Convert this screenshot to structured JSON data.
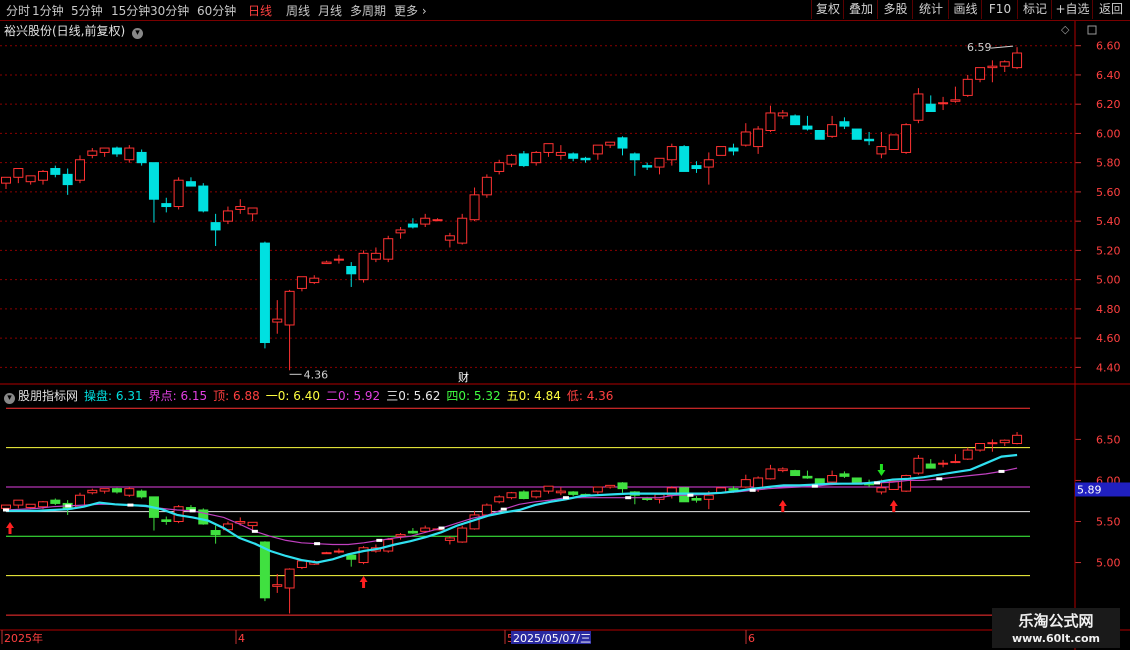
{
  "toolbar": {
    "periods": [
      "分时",
      "1分钟",
      "5分钟",
      "15分钟",
      "30分钟",
      "60分钟",
      "日线",
      "周线",
      "月线",
      "多周期",
      "更多"
    ],
    "active_period": "日线",
    "right_buttons": [
      "复权",
      "叠加",
      "多股",
      "统计",
      "画线",
      "F10",
      "标记",
      "+自选",
      "返回"
    ]
  },
  "main_panel": {
    "title": "裕兴股份(日线,前复权)",
    "high_label": "6.59",
    "low_label": "4.36",
    "finance_marker": "财",
    "y_ticks": [
      "6.60",
      "6.40",
      "6.20",
      "6.00",
      "5.80",
      "5.60",
      "5.40",
      "5.20",
      "5.00",
      "4.80",
      "4.60",
      "4.40"
    ]
  },
  "indicator_panel": {
    "title": "股朋指标网",
    "values": [
      {
        "label": "操盘:",
        "value": "6.31",
        "color": "#00e0e0"
      },
      {
        "label": "界点:",
        "value": "6.15",
        "color": "#e040e0"
      },
      {
        "label": "顶:",
        "value": "6.88",
        "color": "#ff4040"
      },
      {
        "label": "一0:",
        "value": "6.40",
        "color": "#ffff40"
      },
      {
        "label": "二0:",
        "value": "5.92",
        "color": "#e040e0"
      },
      {
        "label": "三0:",
        "value": "5.62",
        "color": "#e8e8e8"
      },
      {
        "label": "四0:",
        "value": "5.32",
        "color": "#40ff40"
      },
      {
        "label": "五0:",
        "value": "4.84",
        "color": "#ffff40"
      },
      {
        "label": "低:",
        "value": "4.36",
        "color": "#ff4040"
      }
    ],
    "y_ticks": [
      "6.50",
      "6.00",
      "5.50",
      "5.00"
    ],
    "current_price_tag": "5.89"
  },
  "time_axis": {
    "labels": [
      "2025年",
      "4",
      "5",
      "6"
    ],
    "cursor_date": "2025/05/07/三"
  },
  "watermark": {
    "line1": "乐淘公式网",
    "line2": "www.60lt.com"
  },
  "colors": {
    "up": "#ff3232",
    "down": "#00e0e0",
    "grid": "#8a0000",
    "bg": "#000000",
    "blue_line": "#2020c0",
    "magenta_line": "#a020c0"
  },
  "candles": [
    [
      5.66,
      5.7,
      5.62,
      5.7
    ],
    [
      5.7,
      5.76,
      5.66,
      5.76
    ],
    [
      5.67,
      5.71,
      5.65,
      5.71
    ],
    [
      5.68,
      5.75,
      5.65,
      5.74
    ],
    [
      5.76,
      5.78,
      5.7,
      5.72
    ],
    [
      5.72,
      5.76,
      5.58,
      5.65
    ],
    [
      5.68,
      5.85,
      5.66,
      5.82
    ],
    [
      5.85,
      5.9,
      5.83,
      5.88
    ],
    [
      5.87,
      5.9,
      5.84,
      5.9
    ],
    [
      5.9,
      5.91,
      5.84,
      5.86
    ],
    [
      5.82,
      5.92,
      5.8,
      5.9
    ],
    [
      5.87,
      5.89,
      5.78,
      5.8
    ],
    [
      5.8,
      5.8,
      5.39,
      5.55
    ],
    [
      5.52,
      5.56,
      5.46,
      5.5
    ],
    [
      5.5,
      5.7,
      5.48,
      5.68
    ],
    [
      5.67,
      5.7,
      5.64,
      5.64
    ],
    [
      5.64,
      5.66,
      5.46,
      5.47
    ],
    [
      5.39,
      5.45,
      5.23,
      5.34
    ],
    [
      5.4,
      5.5,
      5.38,
      5.47
    ],
    [
      5.48,
      5.55,
      5.45,
      5.5
    ],
    [
      5.45,
      5.49,
      5.4,
      5.49
    ],
    [
      5.25,
      5.26,
      4.53,
      4.57
    ],
    [
      4.71,
      4.86,
      4.63,
      4.73
    ],
    [
      4.69,
      4.93,
      4.38,
      4.92
    ],
    [
      4.94,
      5.02,
      4.92,
      5.02
    ],
    [
      4.98,
      5.03,
      4.97,
      5.01
    ],
    [
      5.11,
      5.13,
      5.11,
      5.12
    ],
    [
      5.14,
      5.17,
      5.11,
      5.14
    ],
    [
      5.09,
      5.12,
      4.95,
      5.04
    ],
    [
      5.0,
      5.2,
      4.98,
      5.18
    ],
    [
      5.14,
      5.22,
      5.12,
      5.18
    ],
    [
      5.14,
      5.3,
      5.12,
      5.28
    ],
    [
      5.32,
      5.36,
      5.28,
      5.34
    ],
    [
      5.38,
      5.42,
      5.35,
      5.36
    ],
    [
      5.38,
      5.45,
      5.36,
      5.42
    ],
    [
      5.41,
      5.42,
      5.4,
      5.41
    ],
    [
      5.27,
      5.32,
      5.22,
      5.3
    ],
    [
      5.25,
      5.45,
      5.24,
      5.42
    ],
    [
      5.41,
      5.63,
      5.4,
      5.58
    ],
    [
      5.58,
      5.72,
      5.56,
      5.7
    ],
    [
      5.74,
      5.82,
      5.72,
      5.8
    ],
    [
      5.79,
      5.86,
      5.77,
      5.85
    ],
    [
      5.86,
      5.88,
      5.77,
      5.78
    ],
    [
      5.8,
      5.88,
      5.78,
      5.87
    ],
    [
      5.87,
      5.93,
      5.84,
      5.93
    ],
    [
      5.85,
      5.92,
      5.82,
      5.87
    ],
    [
      5.86,
      5.87,
      5.81,
      5.83
    ],
    [
      5.83,
      5.84,
      5.8,
      5.82
    ],
    [
      5.86,
      5.92,
      5.82,
      5.92
    ],
    [
      5.92,
      5.94,
      5.9,
      5.94
    ],
    [
      5.97,
      5.98,
      5.85,
      5.9
    ],
    [
      5.86,
      5.87,
      5.71,
      5.82
    ],
    [
      5.78,
      5.8,
      5.75,
      5.77
    ],
    [
      5.77,
      5.83,
      5.72,
      5.83
    ],
    [
      5.82,
      5.93,
      5.78,
      5.91
    ],
    [
      5.91,
      5.92,
      5.74,
      5.74
    ],
    [
      5.78,
      5.81,
      5.73,
      5.76
    ],
    [
      5.77,
      5.87,
      5.65,
      5.82
    ],
    [
      5.85,
      5.91,
      5.85,
      5.91
    ],
    [
      5.9,
      5.93,
      5.85,
      5.88
    ],
    [
      5.92,
      6.07,
      5.91,
      6.01
    ],
    [
      5.91,
      6.05,
      5.86,
      6.03
    ],
    [
      6.02,
      6.19,
      6.01,
      6.14
    ],
    [
      6.12,
      6.16,
      6.1,
      6.14
    ],
    [
      6.12,
      6.13,
      6.08,
      6.06
    ],
    [
      6.05,
      6.12,
      6.02,
      6.03
    ],
    [
      6.02,
      6.02,
      5.96,
      5.96
    ],
    [
      5.98,
      6.12,
      5.97,
      6.06
    ],
    [
      6.08,
      6.11,
      6.03,
      6.05
    ],
    [
      6.03,
      6.03,
      5.98,
      5.96
    ],
    [
      5.96,
      6.01,
      5.92,
      5.95
    ],
    [
      5.86,
      6.01,
      5.83,
      5.91
    ],
    [
      5.89,
      5.99,
      5.89,
      5.99
    ],
    [
      5.87,
      6.07,
      5.86,
      6.06
    ],
    [
      6.09,
      6.31,
      6.07,
      6.27
    ],
    [
      6.2,
      6.26,
      6.17,
      6.15
    ],
    [
      6.21,
      6.25,
      6.16,
      6.21
    ],
    [
      6.22,
      6.32,
      6.21,
      6.23
    ],
    [
      6.26,
      6.4,
      6.25,
      6.37
    ],
    [
      6.37,
      6.45,
      6.35,
      6.45
    ],
    [
      6.45,
      6.5,
      6.35,
      6.46
    ],
    [
      6.46,
      6.5,
      6.42,
      6.49
    ],
    [
      6.45,
      6.59,
      6.44,
      6.55
    ]
  ],
  "indicator_series": {
    "cyan": [
      5.63,
      5.63,
      5.63,
      5.64,
      5.65,
      5.68,
      5.73,
      5.71,
      5.7,
      5.69,
      5.65,
      5.58,
      5.55,
      5.51,
      5.42,
      5.3,
      5.23,
      5.14,
      5.08,
      5.03,
      5.0,
      5.04,
      5.1,
      5.14,
      5.17,
      5.22,
      5.26,
      5.31,
      5.37,
      5.45,
      5.51,
      5.57,
      5.61,
      5.64,
      5.7,
      5.74,
      5.77,
      5.81,
      5.82,
      5.83,
      5.84,
      5.84,
      5.84,
      5.84,
      5.84,
      5.84,
      5.85,
      5.87,
      5.9,
      5.92,
      5.94,
      5.94,
      5.95,
      5.96,
      5.96,
      5.96,
      5.98,
      6.01,
      6.02,
      6.04,
      6.07,
      6.1,
      6.13,
      6.21,
      6.29,
      6.31
    ],
    "magenta": [
      5.64,
      5.65,
      5.66,
      5.68,
      5.69,
      5.7,
      5.71,
      5.71,
      5.7,
      5.68,
      5.66,
      5.64,
      5.63,
      5.59,
      5.55,
      5.47,
      5.38,
      5.32,
      5.27,
      5.24,
      5.23,
      5.22,
      5.22,
      5.24,
      5.27,
      5.3,
      5.32,
      5.37,
      5.42,
      5.48,
      5.54,
      5.58,
      5.65,
      5.71,
      5.74,
      5.76,
      5.79,
      5.79,
      5.79,
      5.79,
      5.79,
      5.79,
      5.79,
      5.82,
      5.82,
      5.83,
      5.85,
      5.86,
      5.88,
      5.9,
      5.91,
      5.92,
      5.93,
      5.95,
      5.96,
      5.97,
      5.97,
      5.98,
      6.0,
      6.0,
      6.02,
      6.04,
      6.06,
      6.08,
      6.11,
      6.15
    ]
  },
  "signals": {
    "up_arrows_index": [
      0,
      29,
      63,
      72
    ],
    "down_arrow_index": [
      71
    ]
  },
  "indicator_levels": [
    6.88,
    6.4,
    5.92,
    5.62,
    5.32,
    4.84,
    4.36
  ],
  "main_range": [
    4.3,
    6.68
  ],
  "indicator_range": [
    4.3,
    6.98
  ]
}
